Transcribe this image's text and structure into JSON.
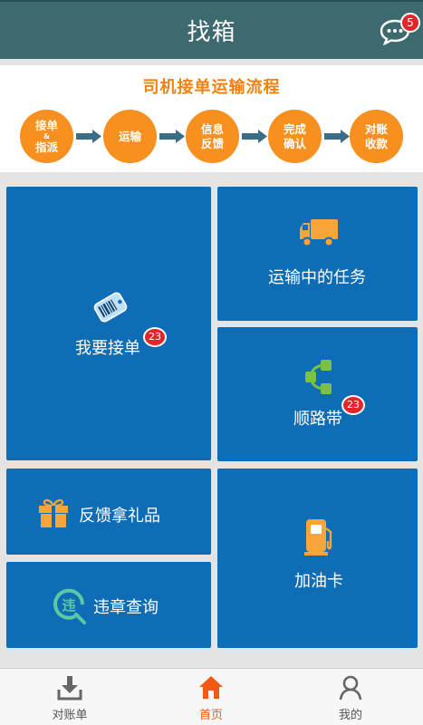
{
  "header": {
    "title": "找箱",
    "message_badge": "5"
  },
  "flow": {
    "title": "司机接单运输流程",
    "steps": [
      {
        "line1": "接单",
        "amp": "&",
        "line2": "指派"
      },
      {
        "line1": "运输"
      },
      {
        "line1": "信息",
        "line2": "反馈"
      },
      {
        "line1": "完成",
        "line2": "确认"
      },
      {
        "line1": "对账",
        "line2": "收款"
      }
    ]
  },
  "tiles": {
    "accept_order": {
      "label": "我要接单",
      "badge": "23",
      "icon": "tag-barcode-icon"
    },
    "tasks_in_transit": {
      "label": "运输中的任务",
      "icon": "truck-icon"
    },
    "on_the_way": {
      "label": "顺路带",
      "badge": "23",
      "icon": "route-icon"
    },
    "feedback_gift": {
      "label": "反馈拿礼品",
      "icon": "gift-icon"
    },
    "violation_query": {
      "label": "违章查询",
      "icon": "violation-search-icon"
    },
    "fuel_card": {
      "label": "加油卡",
      "icon": "fuel-pump-icon"
    }
  },
  "nav": {
    "items": [
      {
        "label": "对账单",
        "icon": "download-tray-icon"
      },
      {
        "label": "首页",
        "icon": "home-icon",
        "active": true
      },
      {
        "label": "我的",
        "icon": "user-icon"
      }
    ]
  },
  "colors": {
    "header": "#3d6a6e",
    "tile": "#0e6db5",
    "accent": "#f7901e",
    "badge": "#e8232a",
    "nav_active": "#f05a14"
  }
}
